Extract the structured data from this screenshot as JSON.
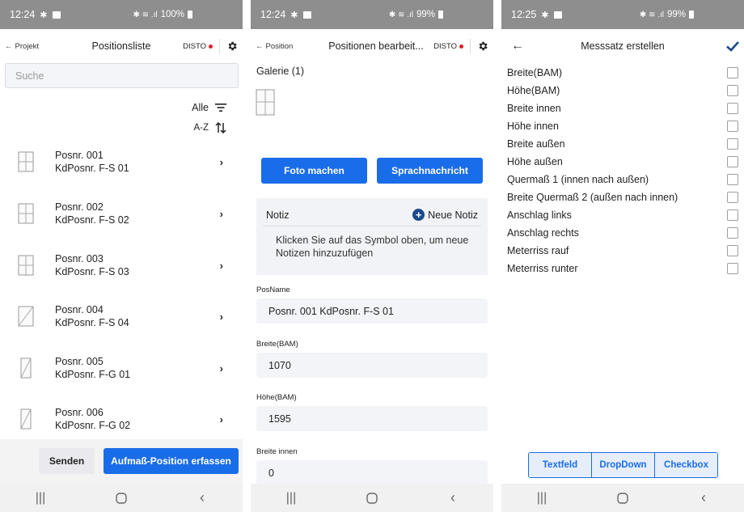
{
  "status": {
    "s1": {
      "time": "12:24",
      "battery": "100%"
    },
    "s2": {
      "time": "12:24",
      "battery": "99%"
    },
    "s3": {
      "time": "12:25",
      "battery": "99%"
    }
  },
  "panel1": {
    "back": "Projekt",
    "title": "Positionsliste",
    "disto": "DISTO",
    "search_placeholder": "Suche",
    "filter_label": "Alle",
    "sort_label": "A-Z",
    "items": [
      {
        "pos": "Posnr. 001",
        "kd": "KdPosnr. F-S 01"
      },
      {
        "pos": "Posnr. 002",
        "kd": "KdPosnr. F-S 02"
      },
      {
        "pos": "Posnr. 003",
        "kd": "KdPosnr. F-S 03"
      },
      {
        "pos": "Posnr. 004",
        "kd": "KdPosnr. F-S 04"
      },
      {
        "pos": "Posnr. 005",
        "kd": "KdPosnr. F-G 01"
      },
      {
        "pos": "Posnr. 006",
        "kd": "KdPosnr. F-G 02"
      }
    ],
    "send_label": "Senden",
    "capture_label": "Aufmaß-Position erfassen"
  },
  "panel2": {
    "back": "Position",
    "title": "Positionen bearbeit...",
    "disto": "DISTO",
    "gallery_label": "Galerie (1)",
    "photo_label": "Foto machen",
    "voice_label": "Sprachnachricht",
    "note_label": "Notiz",
    "new_note_label": "Neue Notiz",
    "note_hint": "Klicken Sie auf das Symbol oben, um neue Notizen hinzuzufügen",
    "fields": [
      {
        "label": "PosName",
        "value": "Posnr. 001  KdPosnr. F-S 01"
      },
      {
        "label": "Breite(BAM)",
        "value": "1070"
      },
      {
        "label": "Höhe(BAM)",
        "value": "1595"
      },
      {
        "label": "Breite innen",
        "value": "0"
      }
    ]
  },
  "panel3": {
    "title": "Messsatz erstellen",
    "items": [
      "Breite(BAM)",
      "Höhe(BAM)",
      "Breite innen",
      "Höhe innen",
      "Breite außen",
      "Höhe außen",
      "Quermaß 1 (innen nach außen)",
      "Breite Quermaß 2 (außen nach innen)",
      "Anschlag links",
      "Anschlag rechts",
      "Meterriss rauf",
      "Meterriss runter"
    ],
    "segments": [
      "Textfeld",
      "DropDown",
      "Checkbox"
    ]
  },
  "colors": {
    "accent": "#1a6de8",
    "statusbar": "#8e8e8e",
    "disto_dot": "#e0202a"
  }
}
